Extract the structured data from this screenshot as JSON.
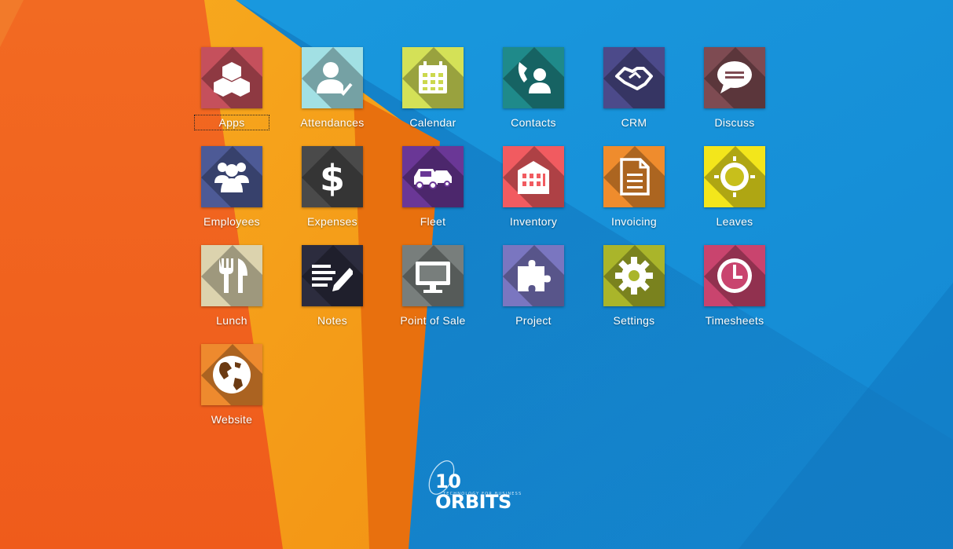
{
  "apps": [
    {
      "label": "Apps",
      "icon": "apps-icon",
      "color": "#c5505c",
      "focused": true
    },
    {
      "label": "Attendances",
      "icon": "attendances-icon",
      "color": "#a2e0e4",
      "focused": false
    },
    {
      "label": "Calendar",
      "icon": "calendar-icon",
      "color": "#d4e157",
      "focused": false
    },
    {
      "label": "Contacts",
      "icon": "contacts-icon",
      "color": "#1f8a8a",
      "focused": false
    },
    {
      "label": "CRM",
      "icon": "crm-icon",
      "color": "#4c4a8a",
      "focused": false
    },
    {
      "label": "Discuss",
      "icon": "discuss-icon",
      "color": "#7e4b52",
      "focused": false
    },
    {
      "label": "Employees",
      "icon": "employees-icon",
      "color": "#4d5a96",
      "focused": false
    },
    {
      "label": "Expenses",
      "icon": "expenses-icon",
      "color": "#4a4a4a",
      "focused": false
    },
    {
      "label": "Fleet",
      "icon": "fleet-icon",
      "color": "#6a3796",
      "focused": false
    },
    {
      "label": "Inventory",
      "icon": "inventory-icon",
      "color": "#f15b60",
      "focused": false
    },
    {
      "label": "Invoicing",
      "icon": "invoicing-icon",
      "color": "#ef8c2d",
      "focused": false
    },
    {
      "label": "Leaves",
      "icon": "leaves-icon",
      "color": "#f3e61b",
      "focused": false
    },
    {
      "label": "Lunch",
      "icon": "lunch-icon",
      "color": "#dcd3ae",
      "focused": false
    },
    {
      "label": "Notes",
      "icon": "notes-icon",
      "color": "#2c2c3e",
      "focused": false
    },
    {
      "label": "Point of Sale",
      "icon": "point-of-sale-icon",
      "color": "#787e7c",
      "focused": false
    },
    {
      "label": "Project",
      "icon": "project-icon",
      "color": "#7a76c0",
      "focused": false
    },
    {
      "label": "Settings",
      "icon": "settings-icon",
      "color": "#aab52a",
      "focused": false
    },
    {
      "label": "Timesheets",
      "icon": "timesheets-icon",
      "color": "#c9446e",
      "focused": false
    },
    {
      "label": "Website",
      "icon": "website-icon",
      "color": "#ee8a2e",
      "focused": false
    }
  ],
  "brand": {
    "name": "10 ORBITS",
    "tagline": "TECHNOLOGY FOR BUSINESS"
  },
  "colors": {
    "bg_blue": "#1592d9",
    "bg_orange": "#f0621f",
    "bg_amber": "#f6a01a",
    "bg_dark_orange": "#e9720f"
  }
}
